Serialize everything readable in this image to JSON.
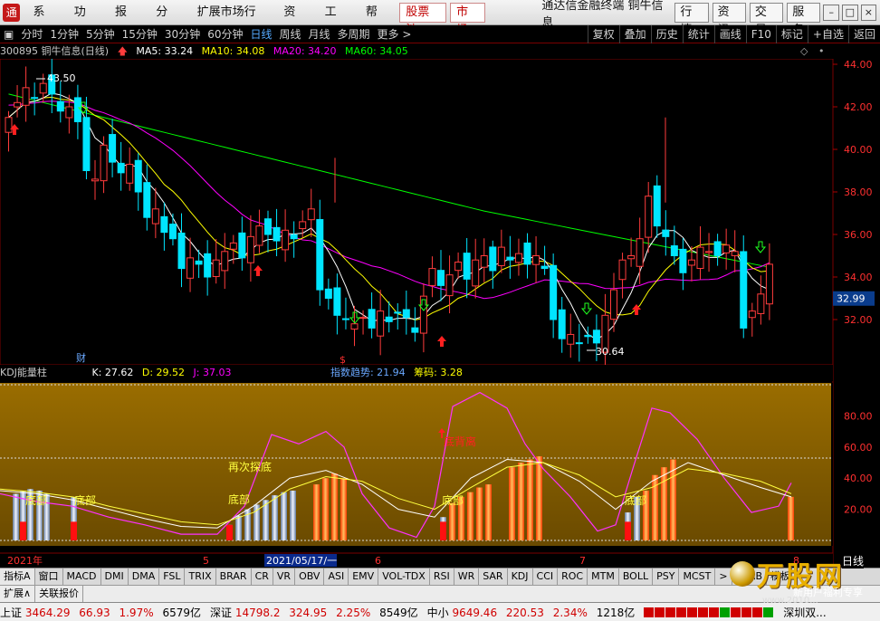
{
  "menu": {
    "items": [
      "系统",
      "功能",
      "报价",
      "分析",
      "扩展市场行情",
      "资讯",
      "工具",
      "帮助"
    ],
    "highlight": [
      "股票池",
      "市场"
    ],
    "app_title": "通达信金融终端  铜牛信息",
    "right_buttons": [
      "行情",
      "资讯",
      "交易",
      "服务"
    ]
  },
  "toolbar": {
    "periods": [
      "分时",
      "1分钟",
      "5分钟",
      "15分钟",
      "30分钟",
      "60分钟",
      "日线",
      "周线",
      "月线",
      "多周期",
      "更多 >"
    ],
    "active": "日线",
    "right": [
      "复权",
      "叠加",
      "历史",
      "统计",
      "画线",
      "F10",
      "标记",
      "+自选",
      "返回"
    ]
  },
  "info": {
    "stock": "300895 铜牛信息(日线)",
    "ma5": "MA5: 33.24",
    "ma10": "MA10: 34.08",
    "ma20": "MA20: 34.20",
    "ma60": "MA60: 34.05"
  },
  "price_axis": {
    "labels": [
      "44.00",
      "42.00",
      "40.00",
      "38.00",
      "36.00",
      "34.00",
      "32.00"
    ],
    "current": "32.99"
  },
  "annotations": {
    "high": "43.50",
    "low": "30.64",
    "finance": "财",
    "dividend": "$"
  },
  "kdj": {
    "title": "KDJ能量柱",
    "k": "K: 27.62",
    "d": "D: 29.52",
    "j": "J: 37.03",
    "trend": "指数趋势: 21.94",
    "chip": "筹码: 3.28",
    "labels": [
      "底部",
      "底部",
      "再次探底",
      "底部",
      "底背离",
      "底部",
      "底部"
    ],
    "axis": [
      "80.00",
      "60.00",
      "40.00",
      "20.00"
    ]
  },
  "date_axis": {
    "labels": [
      "2021年",
      "5",
      "2021/05/17/一",
      "6",
      "7",
      "8"
    ]
  },
  "indicator_tabs": [
    "指标A",
    "窗口",
    "MACD",
    "DMI",
    "DMA",
    "FSL",
    "TRIX",
    "BRAR",
    "CR",
    "VR",
    "OBV",
    "ASI",
    "EMV",
    "VOL-TDX",
    "RSI",
    "WR",
    "SAR",
    "KDJ",
    "CCI",
    "ROC",
    "MTM",
    "BOLL",
    "PSY",
    "MCST",
    ">",
    "指标B",
    "模板"
  ],
  "ext_tabs": [
    "扩展∧",
    "关联报价"
  ],
  "status": {
    "sh_label": "上证",
    "sh_val": "3464.29",
    "sh_chg": "66.93",
    "sh_pct": "1.97%",
    "sh_amt": "6579亿",
    "sz_label": "深证",
    "sz_val": "14798.2",
    "sz_chg": "324.95",
    "sz_pct": "2.25%",
    "sz_amt": "8549亿",
    "zx_label": "中小",
    "zx_val": "9649.46",
    "zx_chg": "220.53",
    "zx_pct": "2.34%",
    "zx_amt": "1218亿",
    "extra": "深圳双..."
  },
  "right_tab": "日线",
  "watermark": {
    "text": "万股网",
    "url": "www.2010...",
    "sub": "新用户福利专享"
  },
  "colors": {
    "up": "#ff3c3c",
    "down": "#00e5ff",
    "ma5": "#ffffff",
    "ma10": "#ffff00",
    "ma20": "#ff00ff",
    "ma60": "#00ff00",
    "kdj_bg": "#b08000"
  }
}
